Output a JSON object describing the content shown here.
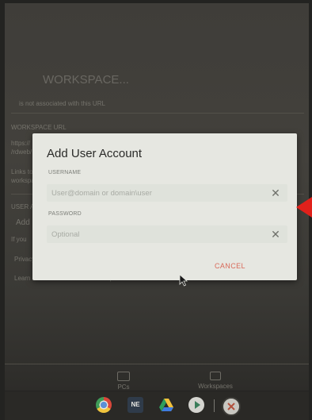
{
  "background": {
    "lines": [
      "WORKSPACE...",
      "is not associated with this URL",
      "WORKSPACE URL",
      "https://",
      "/rdweb/",
      "Links to",
      "workspace",
      "USER A",
      "Add",
      "If you",
      "Privacy",
      "Learn more about Remote Desktop"
    ],
    "bottom_tabs": [
      {
        "label": "PCs"
      },
      {
        "label": "Workspaces"
      }
    ]
  },
  "dialog": {
    "title": "Add User Account",
    "username": {
      "label": "USERNAME",
      "placeholder": "User@domain or domain\\user",
      "value": ""
    },
    "password": {
      "label": "PASSWORD",
      "placeholder": "Optional",
      "value": ""
    },
    "cancel_label": "CANCEL"
  },
  "shelf": {
    "apps": [
      {
        "name": "chrome-icon"
      },
      {
        "name": "ne-app-icon",
        "text": "NE"
      },
      {
        "name": "drive-icon"
      },
      {
        "name": "play-store-icon"
      },
      {
        "name": "remote-desktop-icon"
      }
    ]
  },
  "colors": {
    "dialog_bg": "#e6e7e1",
    "cancel": "#d86a5a",
    "pointer_arrow": "#e0211b"
  }
}
